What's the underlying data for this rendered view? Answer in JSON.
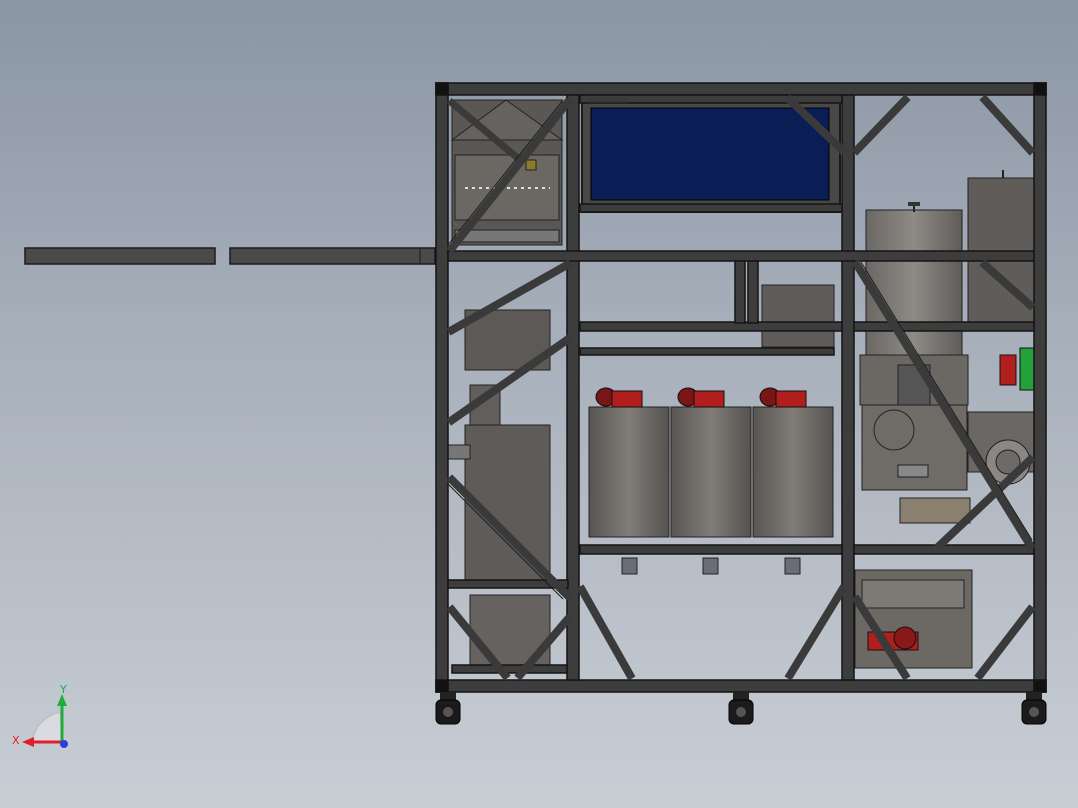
{
  "viewport": {
    "background": "#a3abb6"
  },
  "triad": {
    "x_label": "X",
    "y_label": "Y",
    "x_color": "#e0202a",
    "y_color": "#1fae3a",
    "z_color": "#2a3fd6"
  },
  "colors": {
    "frame": "#3b3b3b",
    "frame_edge": "#1a1a1a",
    "panel": "#5e5b58",
    "tank": "#6a6764",
    "screen": "#0a1d55",
    "motor": "#b01e1e",
    "green_part": "#23a23a"
  },
  "model": {
    "components": [
      "main-frame",
      "extension-rail",
      "control-screen",
      "hopper",
      "storage-tanks",
      "pump-motors",
      "vertical-tank",
      "side-tank",
      "gear-motor",
      "casters"
    ]
  }
}
